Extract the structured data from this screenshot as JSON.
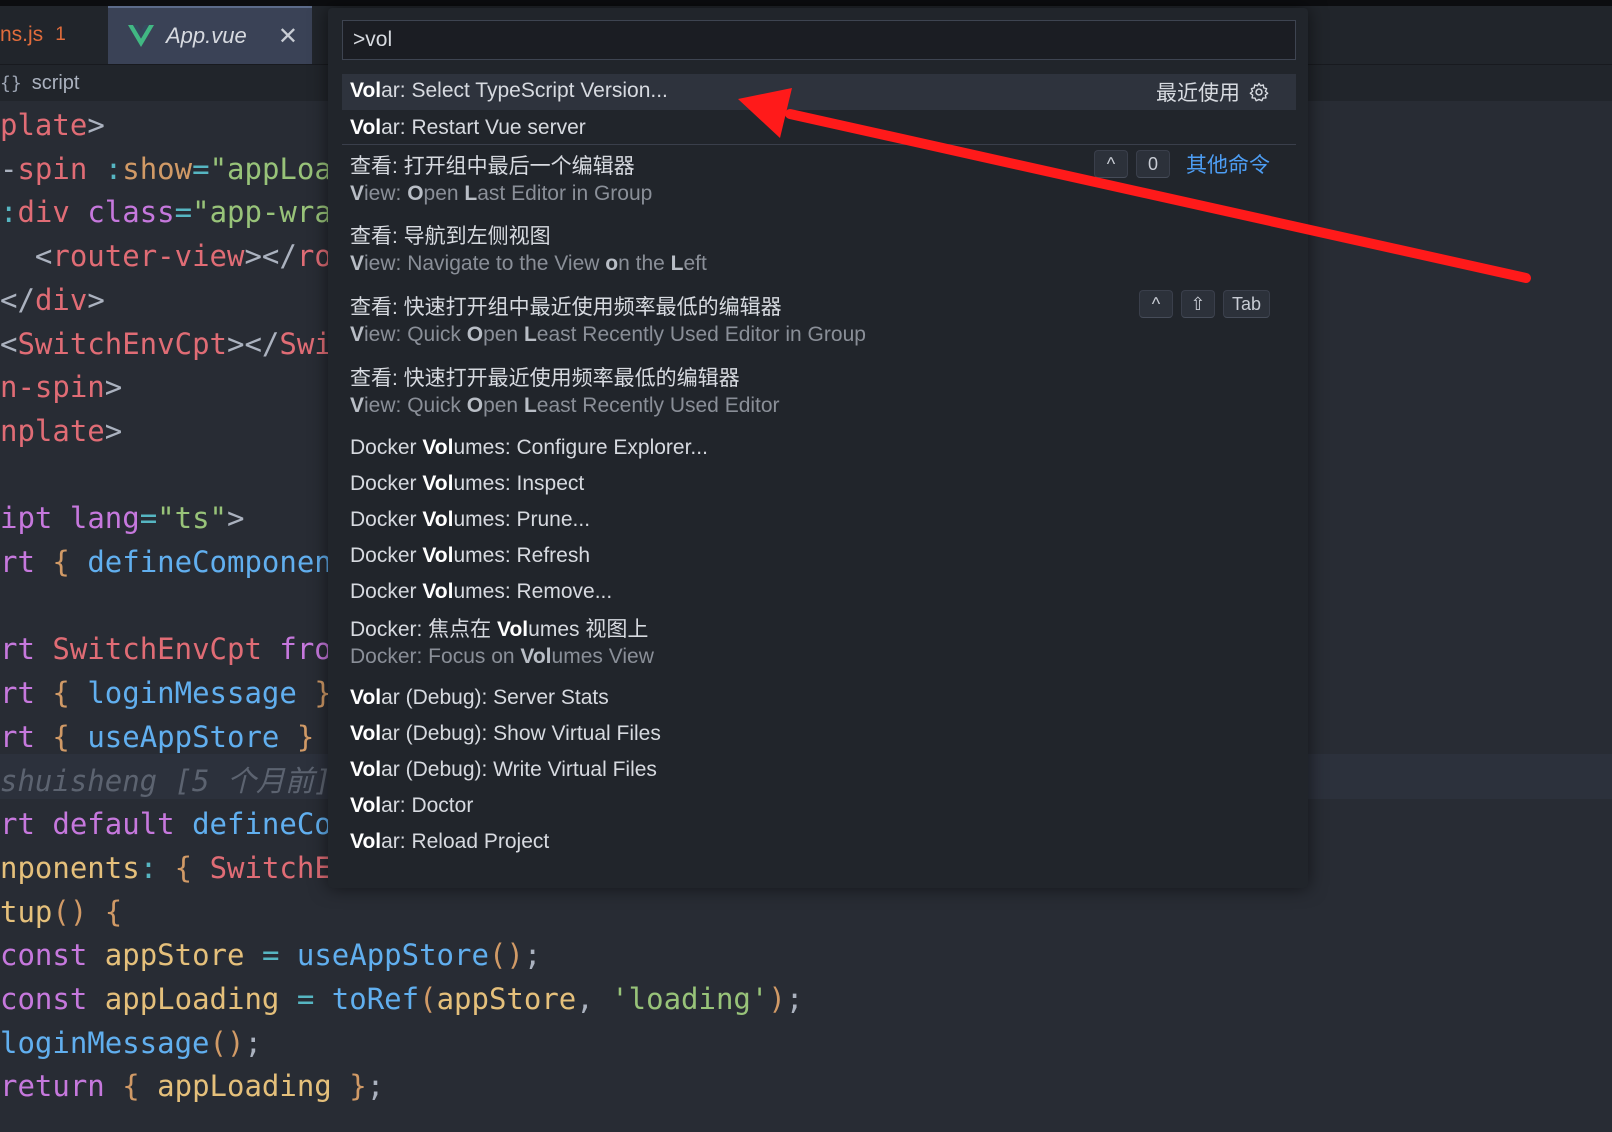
{
  "tabs": [
    {
      "label": "ns.js",
      "badge": "1"
    },
    {
      "label": "App.vue",
      "close": "✕",
      "icon": "vue-logo-icon"
    }
  ],
  "breadcrumb": {
    "icon": "{}",
    "label": "script"
  },
  "palette": {
    "input_value": ">vol",
    "recent_label": "最近使用",
    "other_commands": "其他命令",
    "items": [
      {
        "main": "Volar: Select TypeScript Version..."
      },
      {
        "main": "Volar: Restart Vue server"
      },
      {
        "main": "查看: 打开组中最后一个编辑器",
        "sub": "View: Open Last Editor in Group",
        "keys": [
          "^",
          "0"
        ]
      },
      {
        "main": "查看: 导航到左侧视图",
        "sub": "View: Navigate to the View on the Left"
      },
      {
        "main": "查看: 快速打开组中最近使用频率最低的编辑器",
        "sub": "View: Quick Open Least Recently Used Editor in Group",
        "keys": [
          "^",
          "⇧",
          "Tab"
        ]
      },
      {
        "main": "查看: 快速打开最近使用频率最低的编辑器",
        "sub": "View: Quick Open Least Recently Used Editor"
      },
      {
        "main": "Docker Volumes: Configure Explorer..."
      },
      {
        "main": "Docker Volumes: Inspect"
      },
      {
        "main": "Docker Volumes: Prune..."
      },
      {
        "main": "Docker Volumes: Refresh"
      },
      {
        "main": "Docker Volumes: Remove..."
      },
      {
        "main": "Docker: 焦点在 Volumes 视图上",
        "sub": "Docker: Focus on Volumes View"
      },
      {
        "main": "Volar (Debug): Server Stats"
      },
      {
        "main": "Volar (Debug): Show Virtual Files"
      },
      {
        "main": "Volar (Debug): Write Virtual Files"
      },
      {
        "main": "Volar: Doctor"
      },
      {
        "main": "Volar: Reload Project"
      }
    ]
  },
  "code_lines": [
    "plate>",
    "-spin :show=\"appLoa",
    ":div class=\"app-wra",
    "  <router-view></ro",
    "</div>",
    "<SwitchEnvCpt></Swi",
    "n-spin>",
    "nplate>",
    "",
    "ipt lang=\"ts\">",
    "rt { defineComponen",
    "",
    "rt SwitchEnvCpt fro",
    "rt { loginMessage }",
    "rt { useAppStore }",
    "shuisheng [5 个月前]",
    "rt default defineCo",
    "nponents: { SwitchEnvCpt },",
    "tup() {",
    "const appStore = useAppStore();",
    "const appLoading = toRef(appStore, 'loading');",
    "loginMessage();",
    "return { appLoading };"
  ],
  "colors": {
    "accent": "#4d9ef5",
    "arrow": "#ff1a1a",
    "background": "#282c34"
  }
}
